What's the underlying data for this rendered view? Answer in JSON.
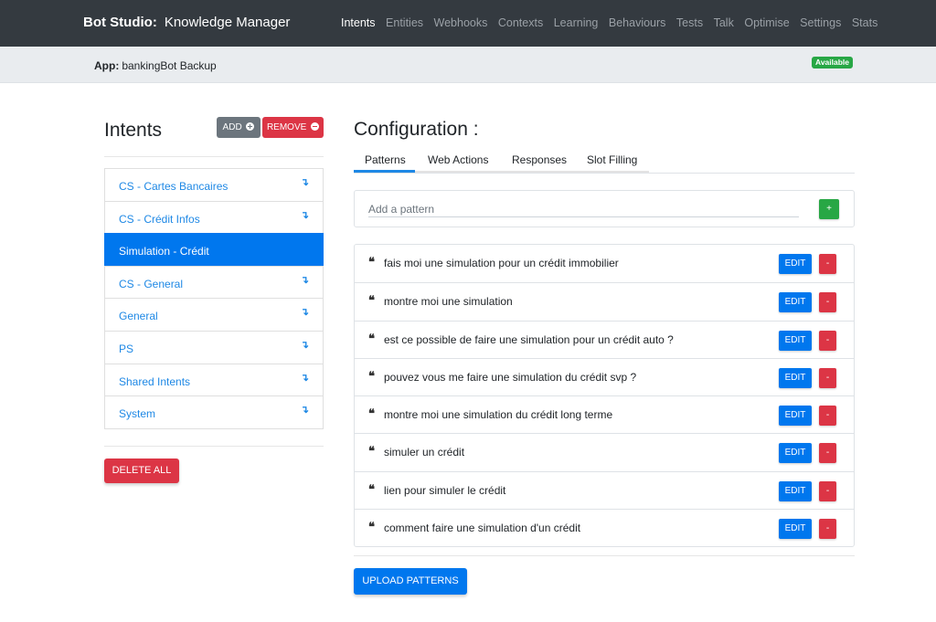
{
  "header": {
    "brand_bold": "Bot Studio:",
    "brand_title": "Knowledge Manager",
    "nav": [
      "Intents",
      "Entities",
      "Webhooks",
      "Contexts",
      "Learning",
      "Behaviours",
      "Tests",
      "Talk",
      "Optimise",
      "Settings",
      "Stats"
    ],
    "active_nav": "Intents"
  },
  "app_bar": {
    "app_label": "App:",
    "app_name": "bankingBot Backup",
    "status": "Available",
    "status_color": "#28a745"
  },
  "intents_panel": {
    "title": "Intents",
    "add_label": "ADD",
    "remove_label": "REMOVE",
    "items": [
      {
        "label": "CS - Cartes Bancaires",
        "has_arrow": true
      },
      {
        "label": "CS - Crédit Infos",
        "has_arrow": true
      },
      {
        "label": "Simulation - Crédit",
        "has_arrow": false
      },
      {
        "label": "CS - General",
        "has_arrow": true
      },
      {
        "label": "General",
        "has_arrow": true
      },
      {
        "label": "PS",
        "has_arrow": true
      },
      {
        "label": "Shared Intents",
        "has_arrow": true
      },
      {
        "label": "System",
        "has_arrow": true
      }
    ],
    "active_item": "Simulation - Crédit",
    "arrow_glyph": "↴",
    "delete_all_label": "DELETE ALL"
  },
  "configuration": {
    "title": "Configuration :",
    "tabs": [
      "Patterns",
      "Web Actions",
      "Responses",
      "Slot Filling"
    ],
    "active_tab": "Patterns",
    "add_pattern_placeholder": "Add a pattern",
    "add_button_label": "+",
    "patterns": [
      "fais moi une simulation pour un crédit immobilier",
      "montre moi une simulation",
      "est ce possible de faire une simulation pour un crédit auto ?",
      "pouvez vous me faire une simulation du crédit svp ?",
      "montre moi une simulation du crédit long terme",
      "simuler un crédit",
      "lien pour simuler le crédit",
      "comment faire une simulation d'un crédit"
    ],
    "quote_glyph": "❝",
    "edit_label": "EDIT",
    "delete_label": "-",
    "upload_label": "UPLOAD PATTERNS"
  },
  "colors": {
    "primary": "#0077ee",
    "danger": "#dc3545",
    "success": "#28a745",
    "navbar": "#343a40"
  }
}
